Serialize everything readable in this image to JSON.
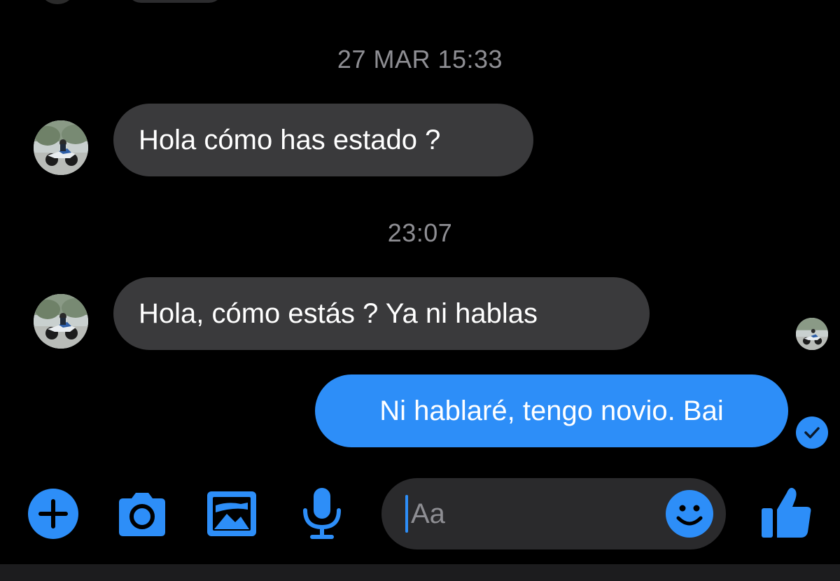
{
  "conversation": {
    "timestamps": [
      "27 MAR 15:33",
      "23:07"
    ],
    "messages": [
      {
        "direction": "incoming",
        "text": "Hola cómo has estado ?"
      },
      {
        "direction": "incoming",
        "text": "Hola, cómo estás ? Ya ni hablas"
      },
      {
        "direction": "outgoing",
        "text": "Ni hablaré, tengo novio. Bai"
      }
    ],
    "read_receipt": "read"
  },
  "composer": {
    "placeholder": "Aa",
    "value": ""
  },
  "toolbar": {
    "icons": [
      "plus-icon",
      "camera-icon",
      "image-icon",
      "mic-icon",
      "emoji-icon",
      "thumbs-up-icon"
    ]
  },
  "colors": {
    "background": "#000000",
    "incoming_bubble": "#3a3a3c",
    "outgoing_bubble": "#2d8ef8",
    "accent": "#2d8ef8",
    "timestamp": "#8e8e93"
  }
}
